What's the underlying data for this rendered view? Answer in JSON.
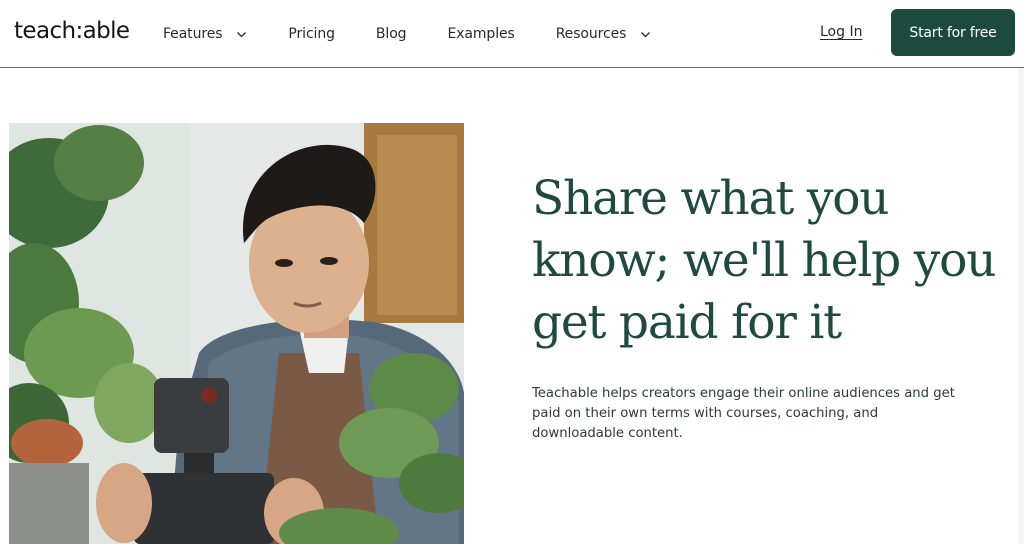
{
  "brand": {
    "logo_text": "teach:able",
    "accent_color": "#1d4a3f",
    "headline_color": "#1f4a3e"
  },
  "nav": {
    "items": [
      {
        "label": "Features",
        "has_dropdown": true
      },
      {
        "label": "Pricing",
        "has_dropdown": false
      },
      {
        "label": "Blog",
        "has_dropdown": false
      },
      {
        "label": "Examples",
        "has_dropdown": false
      },
      {
        "label": "Resources",
        "has_dropdown": true
      }
    ],
    "login_label": "Log In",
    "cta_label": "Start for free"
  },
  "hero": {
    "headline": "Share what you know; we'll help you get paid for it",
    "subtext": "Teachable helps creators engage their online audiences and get paid on their own terms with courses, coaching, and downloadable content.",
    "image_icon": "photo-creator-filming-plant"
  }
}
